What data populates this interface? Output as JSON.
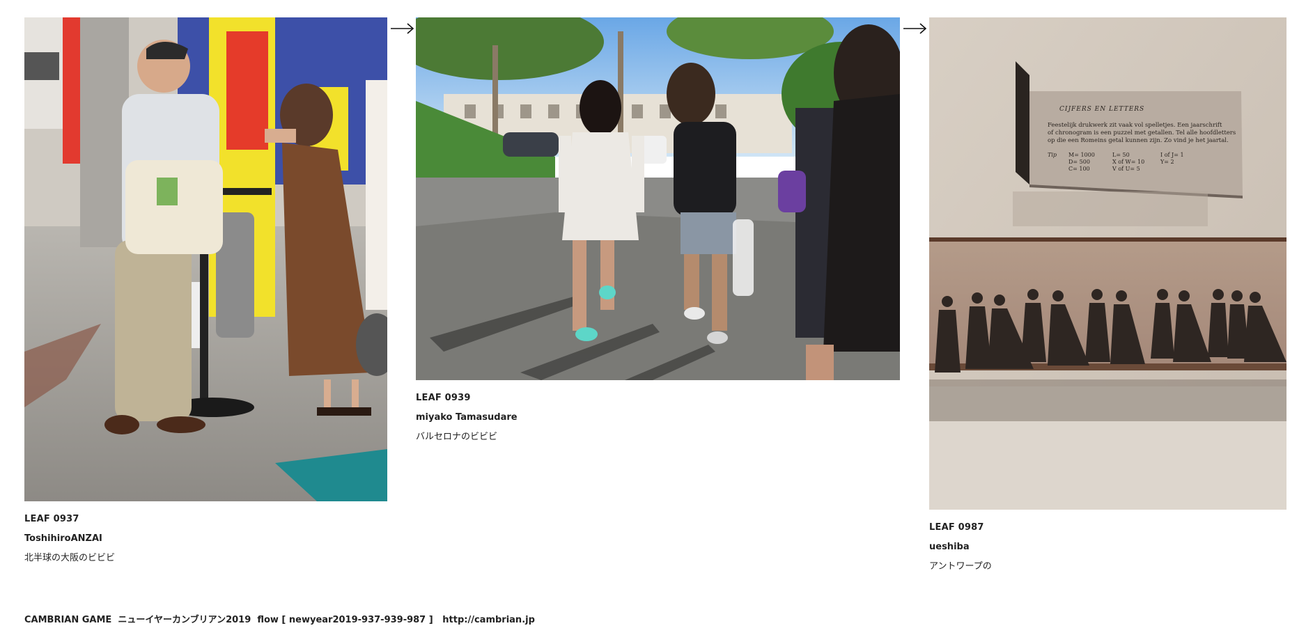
{
  "leaves": [
    {
      "id": "LEAF 0937",
      "author": "ToshihiroANZAI",
      "title": "北半球の大阪のビビビ",
      "image": "photo-osaka-street-smoking-area"
    },
    {
      "id": "LEAF 0939",
      "author": "miyako Tamasudare",
      "title": "バルセロナのビビビ",
      "image": "photo-barcelona-couple-walking"
    },
    {
      "id": "LEAF 0987",
      "author": "ueshiba",
      "title": "アントワープの",
      "image": "photo-antwerp-museum-plaque"
    }
  ],
  "plaque": {
    "heading": "CIJFERS EN LETTERS",
    "line1": "Feestelijk drukwerk zit vaak vol spelletjes. Een jaarschrift",
    "line2": "of chronogram is een puzzel met getallen. Tel alle hoofdletters",
    "line3": "op die een Romeins getal kunnen zijn. Zo vind je het jaartal.",
    "tip": "Tip",
    "col1": [
      "M= 1000",
      "D= 500",
      "C= 100"
    ],
    "col2": [
      "L= 50",
      "X of W= 10",
      "V of U= 5"
    ],
    "col3": [
      "I of J= 1",
      "Y= 2"
    ]
  },
  "footer": {
    "brand": "CAMBRIAN GAME",
    "event": "ニューイヤーカンブリアン2019",
    "flow": "flow [ newyear2019-937-939-987 ]",
    "url": "http://cambrian.jp"
  },
  "icons": {
    "flow_arrow": "right-arrow-icon"
  }
}
